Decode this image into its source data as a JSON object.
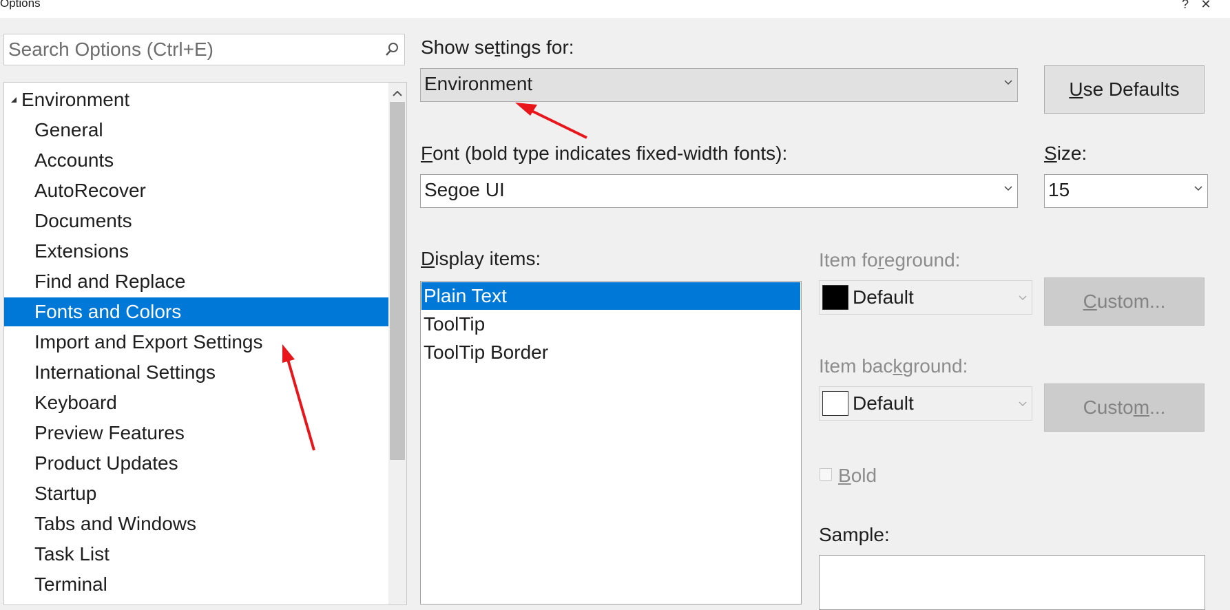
{
  "window": {
    "title": "Options",
    "help_glyph": "?",
    "close_glyph": "✕"
  },
  "search": {
    "placeholder": "Search Options (Ctrl+E)",
    "value": ""
  },
  "tree": {
    "root": "Environment",
    "items": [
      {
        "label": "General",
        "selected": false
      },
      {
        "label": "Accounts",
        "selected": false
      },
      {
        "label": "AutoRecover",
        "selected": false
      },
      {
        "label": "Documents",
        "selected": false
      },
      {
        "label": "Extensions",
        "selected": false
      },
      {
        "label": "Find and Replace",
        "selected": false
      },
      {
        "label": "Fonts and Colors",
        "selected": true
      },
      {
        "label": "Import and Export Settings",
        "selected": false
      },
      {
        "label": "International Settings",
        "selected": false
      },
      {
        "label": "Keyboard",
        "selected": false
      },
      {
        "label": "Preview Features",
        "selected": false
      },
      {
        "label": "Product Updates",
        "selected": false
      },
      {
        "label": "Startup",
        "selected": false
      },
      {
        "label": "Tabs and Windows",
        "selected": false
      },
      {
        "label": "Task List",
        "selected": false
      },
      {
        "label": "Terminal",
        "selected": false
      }
    ]
  },
  "settings": {
    "show_settings_label_pre": "Show se",
    "show_settings_label_ul": "t",
    "show_settings_label_post": "tings for:",
    "show_settings_value": "Environment",
    "use_defaults_ul": "U",
    "use_defaults_rest": "se Defaults",
    "font_label_ul": "F",
    "font_label_rest": "ont (bold type indicates fixed-width fonts):",
    "font_value": "Segoe UI",
    "size_label_ul": "S",
    "size_label_rest": "ize:",
    "size_value": "15",
    "display_items_ul": "D",
    "display_items_rest": "isplay items:",
    "display_items": [
      "Plain Text",
      "ToolTip",
      "ToolTip Border"
    ],
    "selected_display_item": 0,
    "fg_label_pre": "Item fo",
    "fg_label_ul": "r",
    "fg_label_post": "eground:",
    "fg_value": "Default",
    "fg_color": "#000000",
    "custom_fg_ul": "C",
    "custom_fg_rest": "ustom...",
    "bg_label_pre": "Item bac",
    "bg_label_ul": "k",
    "bg_label_post": "ground:",
    "bg_value": "Default",
    "bg_color": "#ffffff",
    "custom_bg_pre": "Custo",
    "custom_bg_ul": "m",
    "custom_bg_post": "...",
    "bold_ul": "B",
    "bold_rest": "old",
    "bold_checked": false,
    "sample_label": "Sample:"
  },
  "colors": {
    "selection": "#0078d7",
    "annotation_arrow": "#e8151b"
  }
}
